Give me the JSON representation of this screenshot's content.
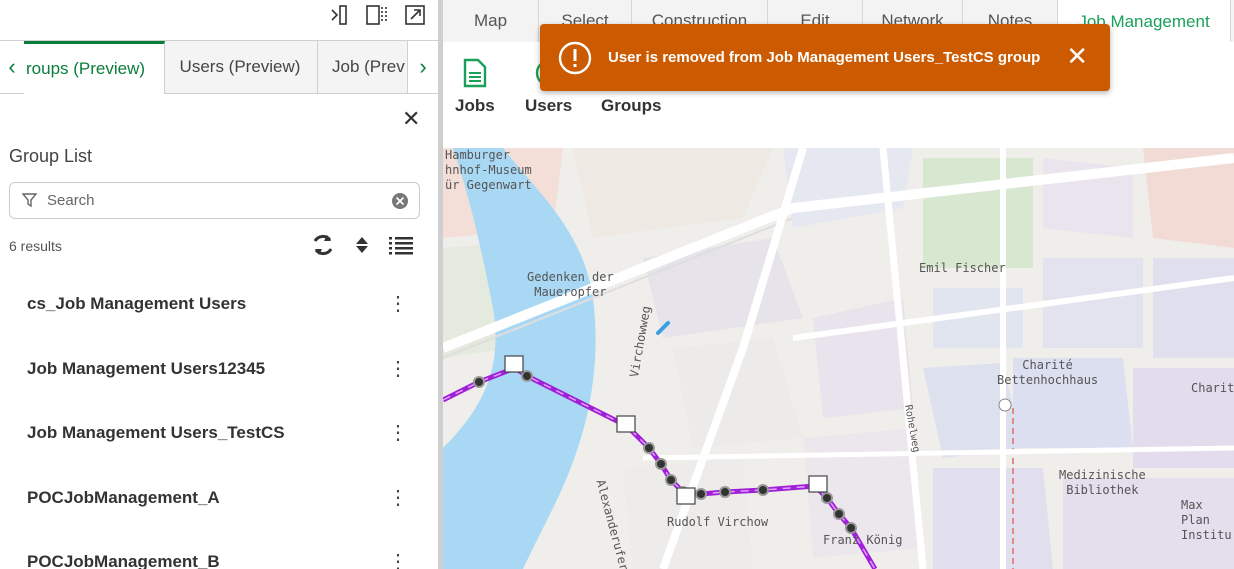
{
  "left_panel": {
    "tabs": [
      {
        "label": "roups (Preview)",
        "active": true
      },
      {
        "label": "Users (Preview)",
        "active": false
      },
      {
        "label": "Job (Prev",
        "active": false
      }
    ],
    "title": "Group List",
    "search": {
      "placeholder": "Search",
      "value": ""
    },
    "results_count": "6 results",
    "groups": [
      {
        "label": "cs_Job Management Users"
      },
      {
        "label": "Job Management Users12345"
      },
      {
        "label": "Job Management Users_TestCS"
      },
      {
        "label": "POCJobManagement_A"
      },
      {
        "label": "POCJobManagement_B"
      }
    ]
  },
  "ribbon": {
    "tabs": [
      {
        "label": "Map"
      },
      {
        "label": "Select"
      },
      {
        "label": "Construction"
      },
      {
        "label": "Edit"
      },
      {
        "label": "Network"
      },
      {
        "label": "Notes"
      },
      {
        "label": "Job Management",
        "active": true
      }
    ],
    "buttons": [
      {
        "label": "Jobs",
        "icon": "document-icon"
      },
      {
        "label": "Users",
        "icon": "users-icon"
      },
      {
        "label": "Groups",
        "icon": "groups-icon"
      }
    ]
  },
  "toast": {
    "message": "User is removed from Job Management Users_TestCS group",
    "color": "#cc5a00"
  },
  "map": {
    "labels": [
      {
        "text": "Hamburger\nhnhof-Museum\nür Gegenwart"
      },
      {
        "text": "Gedenken der\nMaueropfer"
      },
      {
        "text": "Emil Fischer"
      },
      {
        "text": "Charité\nBettenhochhaus"
      },
      {
        "text": "Charite"
      },
      {
        "text": "Rudolf Virchow"
      },
      {
        "text": "Franz König"
      },
      {
        "text": "Medizinische\nBibliothek"
      },
      {
        "text": "Max Plan\nInstitu"
      },
      {
        "text": "Virchowweg"
      },
      {
        "text": "Alexanderufer"
      },
      {
        "text": "Rohelweg"
      }
    ],
    "route_color": "#a020d8"
  },
  "colors": {
    "accent_green": "#0a7d3b",
    "toast_orange": "#cc5a00"
  }
}
